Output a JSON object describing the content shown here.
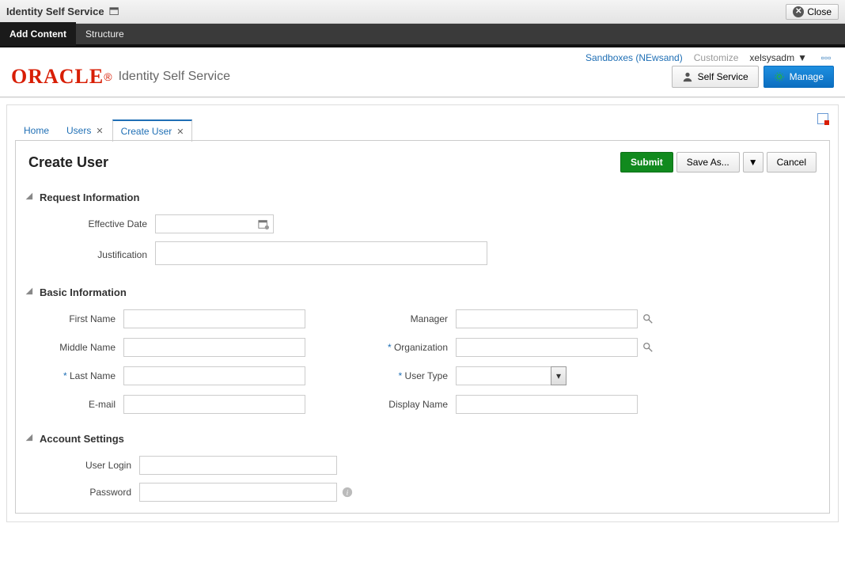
{
  "topbar": {
    "title": "Identity Self Service",
    "close": "Close"
  },
  "editbar": {
    "add_content": "Add Content",
    "structure": "Structure"
  },
  "header": {
    "sandboxes": "Sandboxes (NEwsand)",
    "customize": "Customize",
    "user": "xelsysadm"
  },
  "brand": {
    "logo": "ORACLE",
    "sub": "Identity Self Service",
    "self_service": "Self Service",
    "manage": "Manage"
  },
  "tabs": {
    "home": "Home",
    "users": "Users",
    "create_user": "Create User"
  },
  "page": {
    "title": "Create User",
    "submit": "Submit",
    "save_as": "Save As...",
    "cancel": "Cancel"
  },
  "sections": {
    "request_info": "Request Information",
    "basic_info": "Basic Information",
    "account_settings": "Account Settings"
  },
  "labels": {
    "effective_date": "Effective Date",
    "justification": "Justification",
    "first_name": "First Name",
    "middle_name": "Middle Name",
    "last_name": "Last Name",
    "email": "E-mail",
    "manager": "Manager",
    "organization": "Organization",
    "user_type": "User Type",
    "display_name": "Display Name",
    "user_login": "User Login",
    "password": "Password"
  }
}
